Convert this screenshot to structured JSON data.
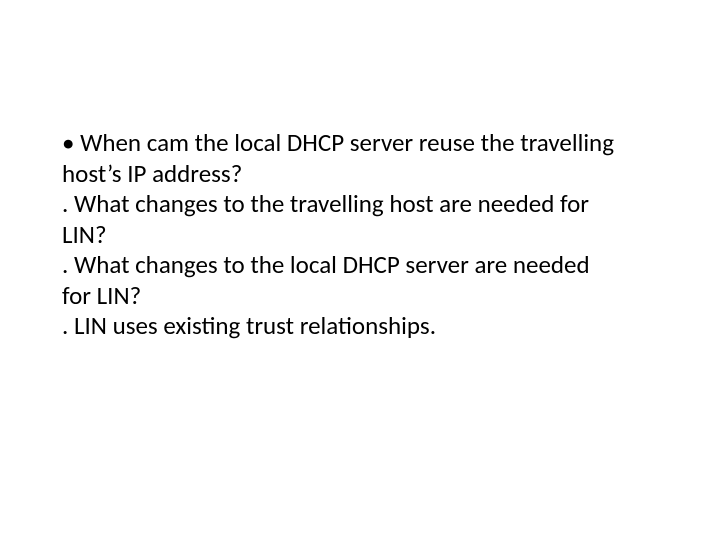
{
  "slide": {
    "items": [
      {
        "marker": " • ",
        "text": "When cam the local DHCP server reuse the travelling host’s IP address?"
      },
      {
        "marker": ". ",
        "text": "What changes to the travelling host are needed for LIN?"
      },
      {
        "marker": ". ",
        "text": "What changes to the local DHCP server are needed for LIN?"
      },
      {
        "marker": ". ",
        "text": "LIN uses existing trust relationships."
      }
    ]
  }
}
